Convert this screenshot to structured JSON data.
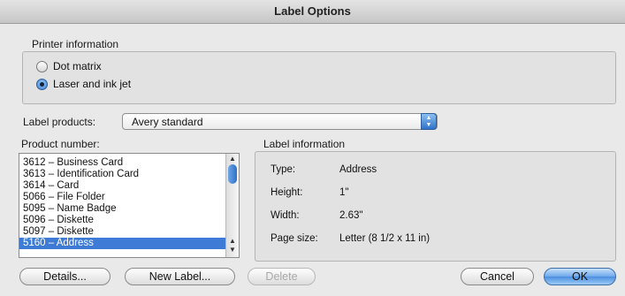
{
  "window": {
    "title": "Label Options"
  },
  "printer": {
    "group_label": "Printer information",
    "options": [
      {
        "label": "Dot matrix",
        "selected": false
      },
      {
        "label": "Laser and ink jet",
        "selected": true
      }
    ]
  },
  "products": {
    "label": "Label products:",
    "selected": "Avery standard"
  },
  "product_number": {
    "label": "Product number:",
    "items": [
      "3612 – Business Card",
      "3613 – Identification Card",
      "3614 – Card",
      "5066 – File Folder",
      "5095 – Name Badge",
      "5096 – Diskette",
      "5097 – Diskette",
      "5160 – Address"
    ],
    "selected_index": 7
  },
  "label_info": {
    "group_label": "Label information",
    "type_label": "Type:",
    "type_value": "Address",
    "height_label": "Height:",
    "height_value": "1\"",
    "width_label": "Width:",
    "width_value": "2.63\"",
    "page_size_label": "Page size:",
    "page_size_value": "Letter (8 1/2 x 11 in)"
  },
  "buttons": {
    "details": "Details...",
    "new_label": "New Label...",
    "delete": "Delete",
    "cancel": "Cancel",
    "ok": "OK"
  },
  "colors": {
    "accent": "#3d7bd6",
    "default_button": "#6da8ea"
  }
}
